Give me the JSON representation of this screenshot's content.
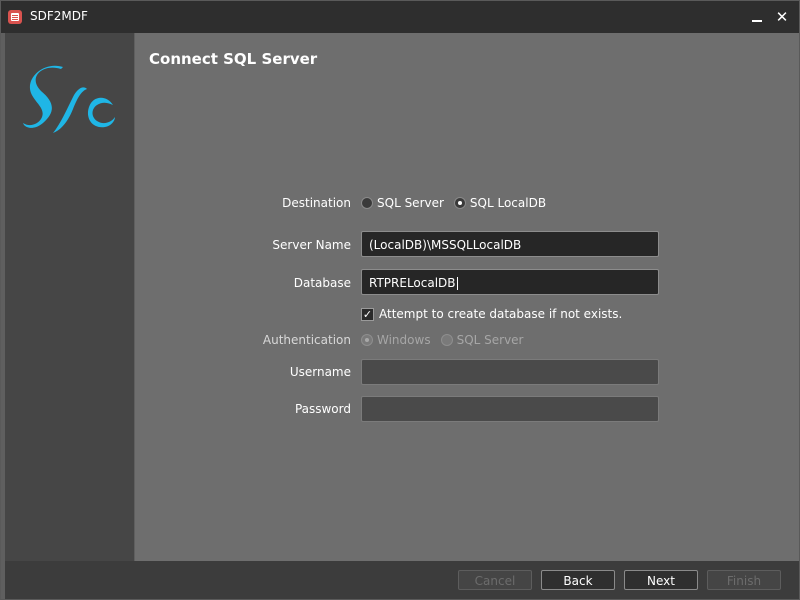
{
  "window": {
    "title": "SDF2MDF",
    "minimize_glyph": "",
    "close_glyph": "✕"
  },
  "sidebar": {
    "logo_icon": "sc-logo",
    "logo_color": "#1fb6e6"
  },
  "page": {
    "title": "Connect SQL Server"
  },
  "form": {
    "destination": {
      "label": "Destination",
      "options": [
        {
          "label": "SQL Server",
          "selected": false
        },
        {
          "label": "SQL LocalDB",
          "selected": true
        }
      ]
    },
    "server_name": {
      "label": "Server Name",
      "value": "(LocalDB)\\MSSQLLocalDB"
    },
    "database": {
      "label": "Database",
      "value": "RTPRELocalDB"
    },
    "create_db": {
      "label": "Attempt to create database if not exists.",
      "checked": true,
      "check_glyph": "✓"
    },
    "authentication": {
      "label": "Authentication",
      "options": [
        {
          "label": "Windows",
          "selected": true
        },
        {
          "label": "SQL Server",
          "selected": false
        }
      ],
      "enabled": false
    },
    "username": {
      "label": "Username",
      "value": ""
    },
    "password": {
      "label": "Password",
      "value": ""
    }
  },
  "footer": {
    "cancel_label": "Cancel",
    "back_label": "Back",
    "next_label": "Next",
    "finish_label": "Finish"
  }
}
